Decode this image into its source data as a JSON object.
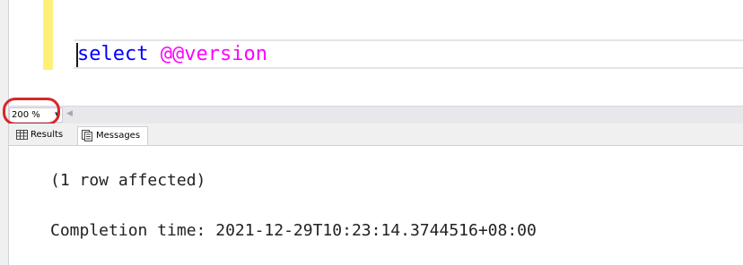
{
  "editor": {
    "keyword": "select",
    "space": " ",
    "variable": "@@version"
  },
  "zoom": {
    "value": "200 %"
  },
  "tabs": [
    {
      "label": "Results",
      "icon": "grid-icon"
    },
    {
      "label": "Messages",
      "icon": "messages-icon"
    }
  ],
  "messages": {
    "rows_affected": "(1 row affected)",
    "completion": "Completion time: 2021-12-29T10:23:14.3744516+08:00"
  },
  "colors": {
    "keyword": "#0000ff",
    "variable": "#ff00ff",
    "change_bar": "#fff07a",
    "annotation_circle": "#d8262c"
  }
}
